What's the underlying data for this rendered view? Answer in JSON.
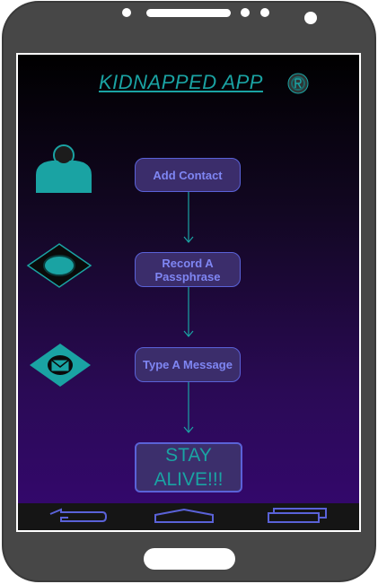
{
  "app": {
    "title": "KIDNAPPED APP",
    "logo_icon": "app-logo-icon"
  },
  "steps": [
    {
      "label": "Add Contact",
      "icon": "contact-person-icon"
    },
    {
      "label": "Record A Passphrase",
      "icon": "record-icon"
    },
    {
      "label": "Type A Message",
      "icon": "envelope-icon"
    }
  ],
  "final_step": {
    "label": "STAY ALIVE!!!"
  },
  "nav": {
    "icons": [
      "back-icon",
      "home-icon",
      "recent-apps-icon"
    ]
  },
  "colors": {
    "accent_teal": "#1aa3a3",
    "button_text": "#7f86f3",
    "button_border": "#5a62d8",
    "button_fill": "#3b2d6b"
  }
}
